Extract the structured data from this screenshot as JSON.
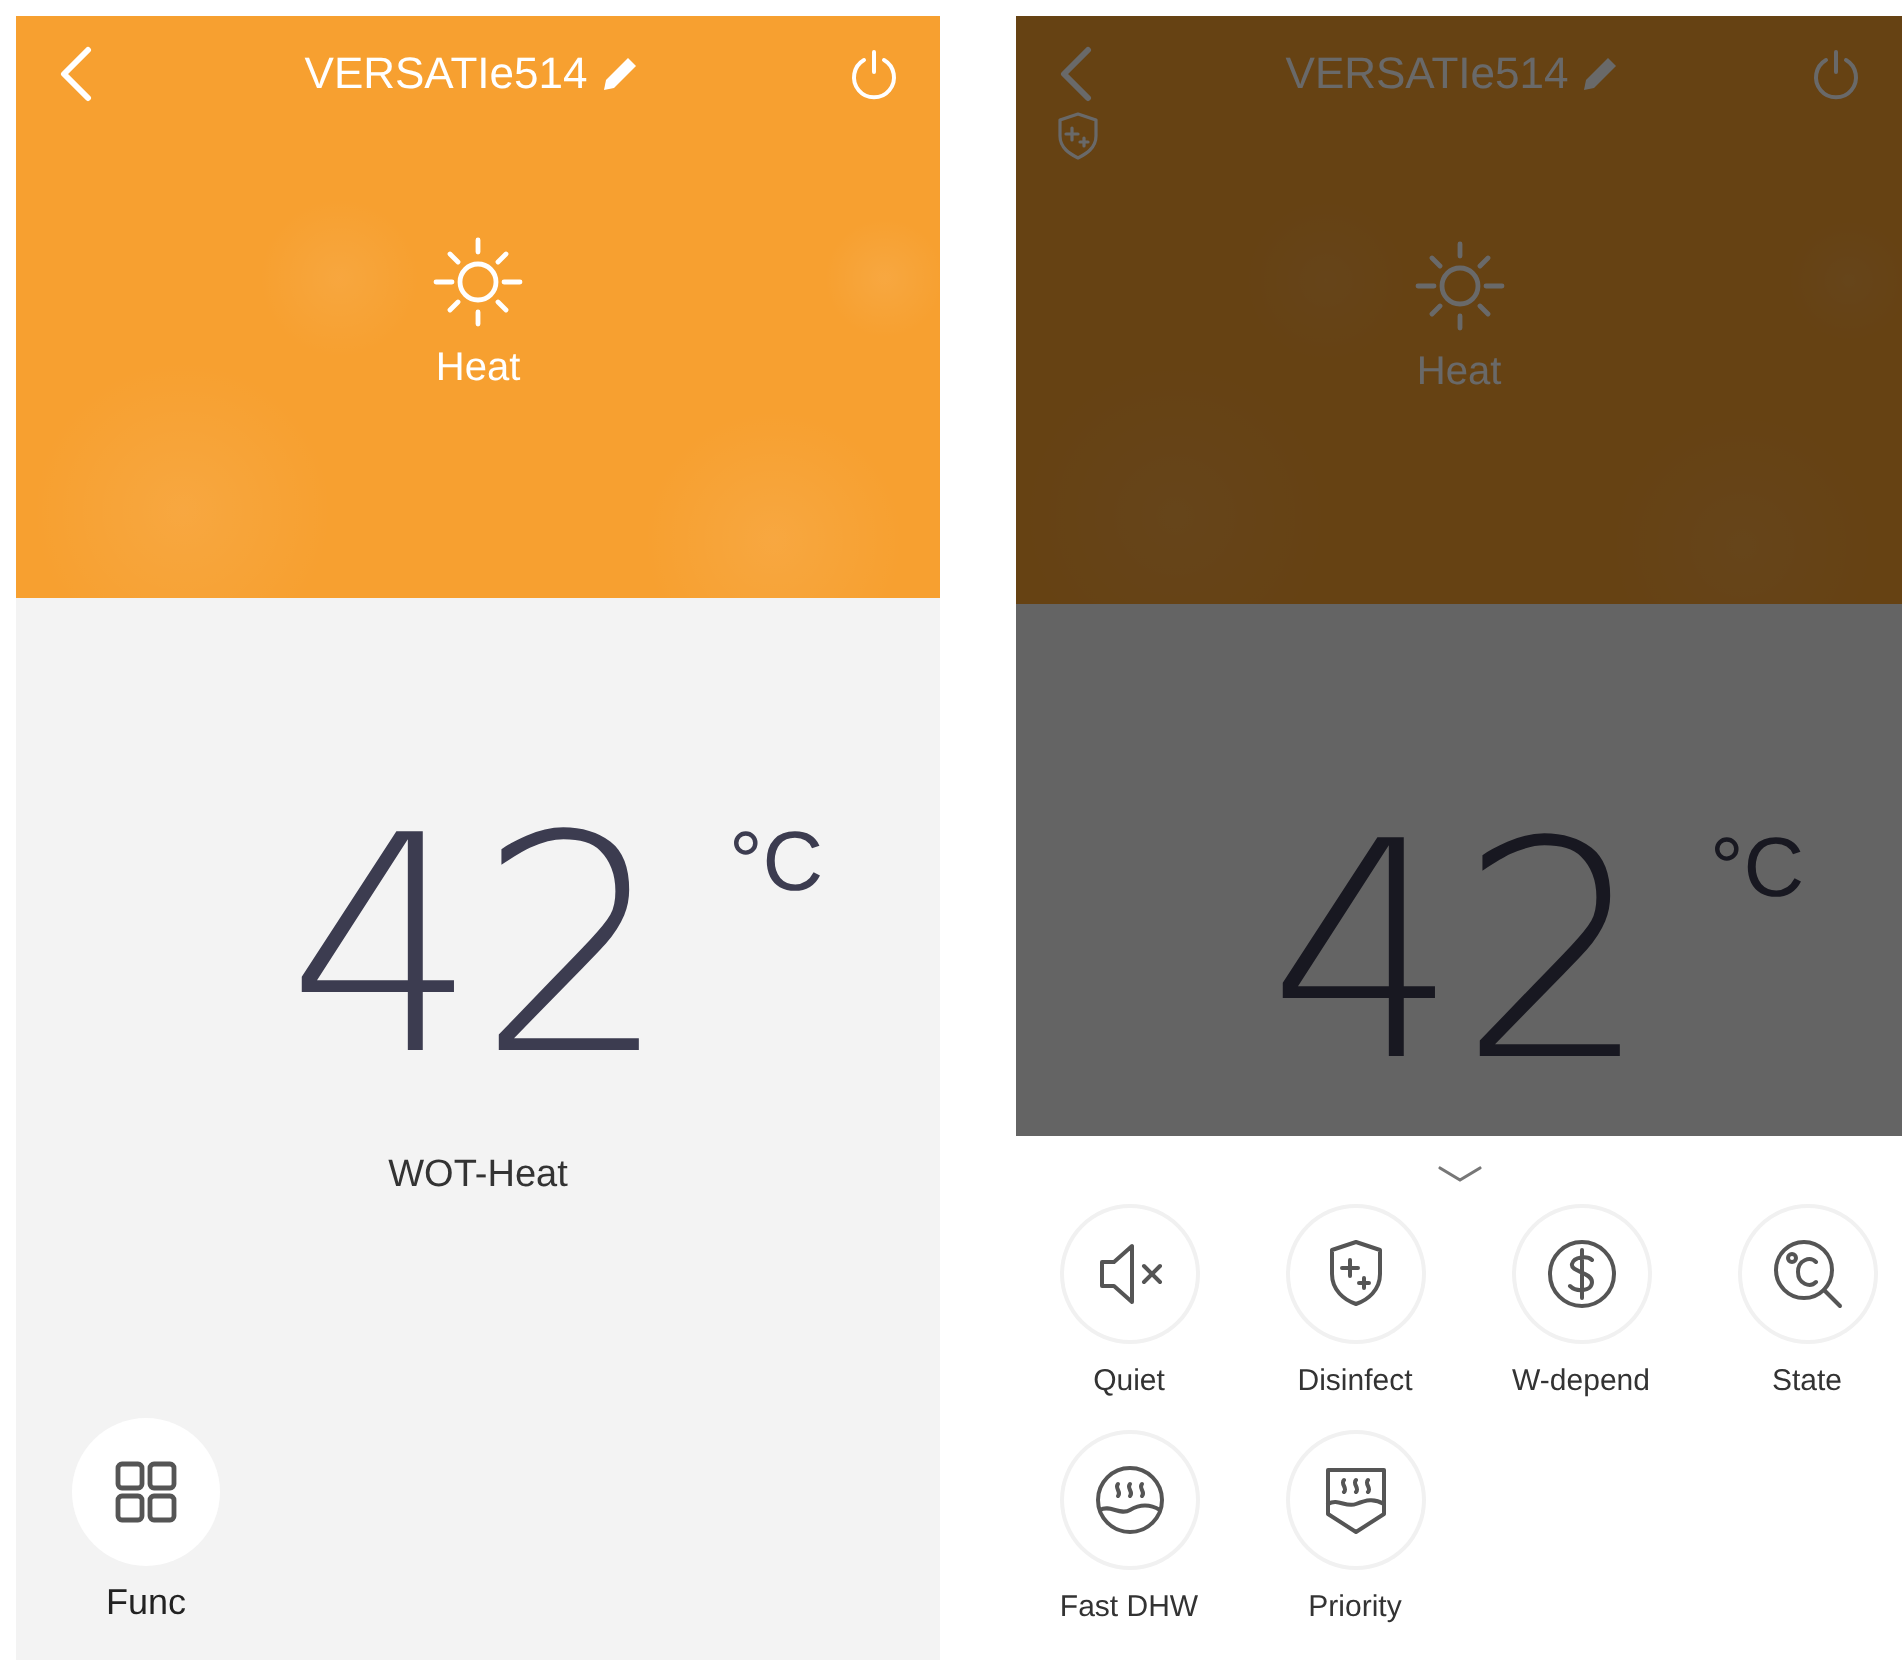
{
  "screens": [
    {
      "kind": "main",
      "title": "VERSATIe514",
      "mode": "Heat",
      "temperature": "42",
      "unit": "°C",
      "mode_label": "WOT-Heat",
      "func_label": "Func"
    },
    {
      "kind": "functions_open",
      "title": "VERSATIe514",
      "disinfect_on": true,
      "mode": "Heat",
      "temperature": "42",
      "unit": "°C",
      "functions": [
        {
          "label": "Quiet",
          "kind": "mute"
        },
        {
          "label": "Disinfect",
          "kind": "shield"
        },
        {
          "label": "W-depend",
          "kind": "dollar"
        },
        {
          "label": "State",
          "kind": "thermo"
        },
        {
          "label": "Fast DHW",
          "kind": "heater"
        },
        {
          "label": "Priority",
          "kind": "tank"
        }
      ]
    }
  ]
}
